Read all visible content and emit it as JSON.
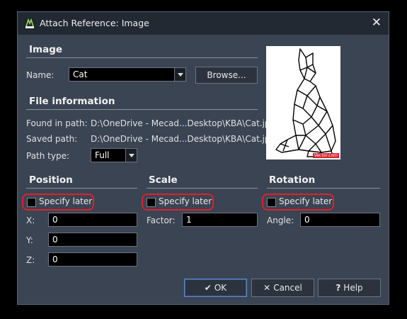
{
  "dialog": {
    "title": "Attach Reference: Image"
  },
  "image_section": {
    "heading": "Image",
    "name_label": "Name:",
    "name_value": "Cat",
    "browse_label": "Browse..."
  },
  "file_info": {
    "heading": "File information",
    "found_label": "Found in path:",
    "found_value": "D:\\OneDrive - Mecad...Desktop\\KBA\\Cat.jpg",
    "saved_label": "Saved path:",
    "saved_value": "D:\\OneDrive - Mecad...Desktop\\KBA\\Cat.jpg",
    "path_type_label": "Path type:",
    "path_type_value": "Full"
  },
  "preview": {
    "watermark": "Vector.com"
  },
  "position": {
    "heading": "Position",
    "specify_later": "Specify later",
    "x_label": "X:",
    "x_value": "0",
    "y_label": "Y:",
    "y_value": "0",
    "z_label": "Z:",
    "z_value": "0"
  },
  "scale": {
    "heading": "Scale",
    "specify_later": "Specify later",
    "factor_label": "Factor:",
    "factor_value": "1"
  },
  "rotation": {
    "heading": "Rotation",
    "specify_later": "Specify later",
    "angle_label": "Angle:",
    "angle_value": "0"
  },
  "buttons": {
    "ok": "OK",
    "cancel": "Cancel",
    "help": "Help"
  },
  "colors": {
    "highlight": "#e0202a",
    "dialog_bg": "#3b4453",
    "titlebar_bg": "#222933"
  }
}
